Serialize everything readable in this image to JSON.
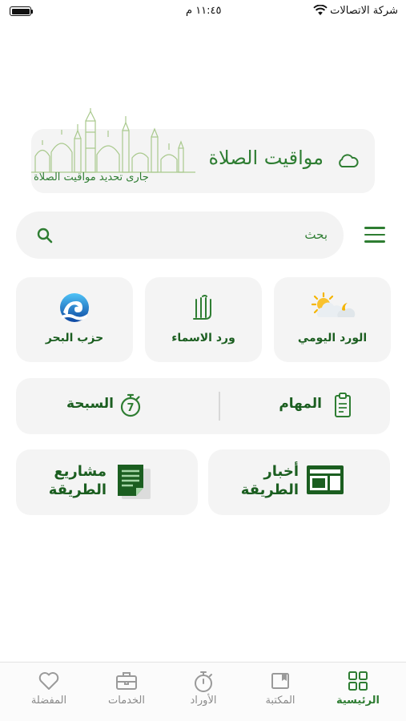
{
  "status_bar": {
    "carrier": "شركة الاتصالات",
    "time": "١١:٤٥ م"
  },
  "prayer_card": {
    "title": "مواقيت الصلاة",
    "subtitle": "جارى تحديد مواقيت الصلاة",
    "icon": "cloud-icon"
  },
  "search": {
    "placeholder": "بحث"
  },
  "tiles": [
    {
      "label": "الورد اليومي",
      "icon": "sun-moon-icon"
    },
    {
      "label": "ورد الاسماء",
      "icon": "allah-calligraphy-icon"
    },
    {
      "label": "حزب البحر",
      "icon": "wave-icon"
    }
  ],
  "wide_row": {
    "tasks_label": "المهام",
    "tasbeeh_label": "السبحة",
    "tasbeeh_counter": "7"
  },
  "big_tiles": {
    "news_line1": "أخبار",
    "news_line2": "الطريقة",
    "projects_line1": "مشاريع",
    "projects_line2": "الطريقة"
  },
  "tab_bar": {
    "active": "home",
    "tabs": [
      {
        "id": "home",
        "label": "الرئيسية",
        "icon": "grid-icon"
      },
      {
        "id": "library",
        "label": "المكتبة",
        "icon": "book-icon"
      },
      {
        "id": "awrad",
        "label": "الأوراد",
        "icon": "stopwatch-icon"
      },
      {
        "id": "services",
        "label": "الخدمات",
        "icon": "briefcase-icon"
      },
      {
        "id": "favorites",
        "label": "المفضلة",
        "icon": "heart-icon"
      }
    ]
  },
  "colors": {
    "primary_green": "#2e7d32",
    "dark_green": "#1b5e20",
    "tile_bg": "#f4f4f4"
  }
}
